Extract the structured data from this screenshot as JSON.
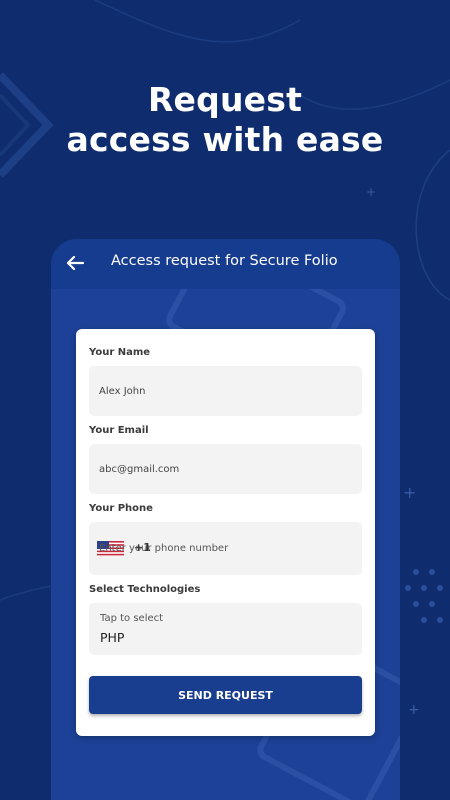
{
  "hero": {
    "line1": "Request",
    "line2": "access with ease"
  },
  "appbar": {
    "title": "Access request for Secure Folio"
  },
  "form": {
    "name": {
      "label": "Your Name",
      "value": "Alex John"
    },
    "email": {
      "label": "Your Email",
      "value": "abc@gmail.com"
    },
    "phone": {
      "label": "Your Phone",
      "country_code": "+1",
      "placeholder": "Enter your phone number",
      "flag": "us-flag-icon"
    },
    "technologies": {
      "label": "Select Technologies",
      "hint": "Tap to select",
      "value": "PHP"
    },
    "submit_label": "SEND REQUEST"
  },
  "colors": {
    "background": "#0f2d6e",
    "phone_frame": "#1c4196",
    "button": "#1a3e8f",
    "field_bg": "#f3f3f3"
  }
}
